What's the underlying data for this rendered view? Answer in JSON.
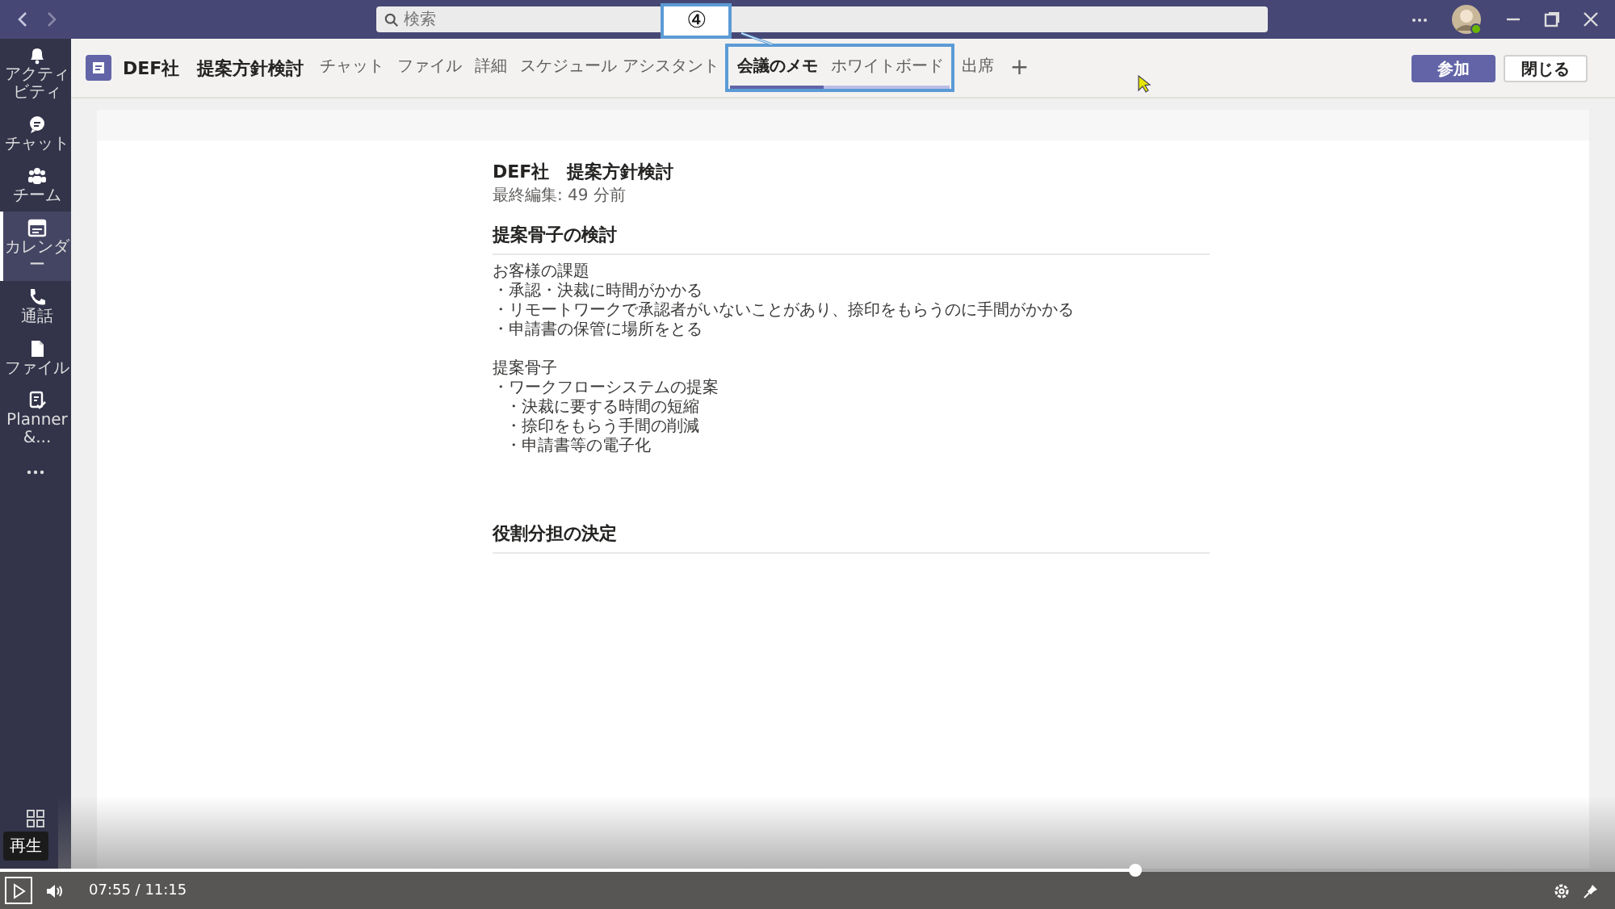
{
  "window": {
    "search_placeholder": "検索"
  },
  "sidebar": {
    "items": [
      {
        "label": "アクティビティ",
        "selected": false
      },
      {
        "label": "チャット",
        "selected": false
      },
      {
        "label": "チーム",
        "selected": false
      },
      {
        "label": "カレンダー",
        "selected": true
      },
      {
        "label": "通話",
        "selected": false
      },
      {
        "label": "ファイル",
        "selected": false
      },
      {
        "label": "Planner &...",
        "selected": false
      }
    ]
  },
  "header": {
    "title": "DEF社　提案方針検討",
    "tabs": [
      {
        "label": "チャット",
        "selected": false,
        "hovered": false,
        "highlighted": false
      },
      {
        "label": "ファイル",
        "selected": false,
        "hovered": false,
        "highlighted": false
      },
      {
        "label": "詳細",
        "selected": false,
        "hovered": false,
        "highlighted": false
      },
      {
        "label": "スケジュール アシスタント",
        "selected": false,
        "hovered": false,
        "highlighted": false
      },
      {
        "label": "会議のメモ",
        "selected": true,
        "hovered": false,
        "highlighted": true
      },
      {
        "label": "ホワイトボード",
        "selected": false,
        "hovered": true,
        "highlighted": true
      },
      {
        "label": "出席",
        "selected": false,
        "hovered": false,
        "highlighted": false
      }
    ],
    "add_tab": "+",
    "buttons": [
      {
        "label": "参加",
        "kind": "primary"
      },
      {
        "label": "閉じる",
        "kind": "secondary"
      }
    ]
  },
  "annotation": {
    "marker": "④"
  },
  "note": {
    "title": "DEF社　提案方針検討",
    "edited": "最終編集: 49 分前",
    "sections": [
      {
        "heading": "提案骨子の検討",
        "paragraphs": [
          [
            {
              "text": "お客様の課題"
            },
            {
              "text": "・承認・決裁に時間がかかる"
            },
            {
              "text": "・リモートワークで承認者がいないことがあり、捺印をもらうのに手間がかかる"
            },
            {
              "text": "・申請書の保管に場所をとる"
            }
          ],
          [
            {
              "text": "提案骨子"
            },
            {
              "text": "・ワークフローシステムの提案",
              "children": [
                {
                  "text": "・決裁に要する時間の短縮"
                },
                {
                  "text": "・捺印をもらう手間の削減"
                },
                {
                  "text": "・申請書等の電子化"
                }
              ]
            }
          ]
        ]
      },
      {
        "heading": "役割分担の決定"
      }
    ]
  },
  "player": {
    "tooltip": "再生",
    "time": "07:55 / 11:15",
    "level": 0.703
  }
}
